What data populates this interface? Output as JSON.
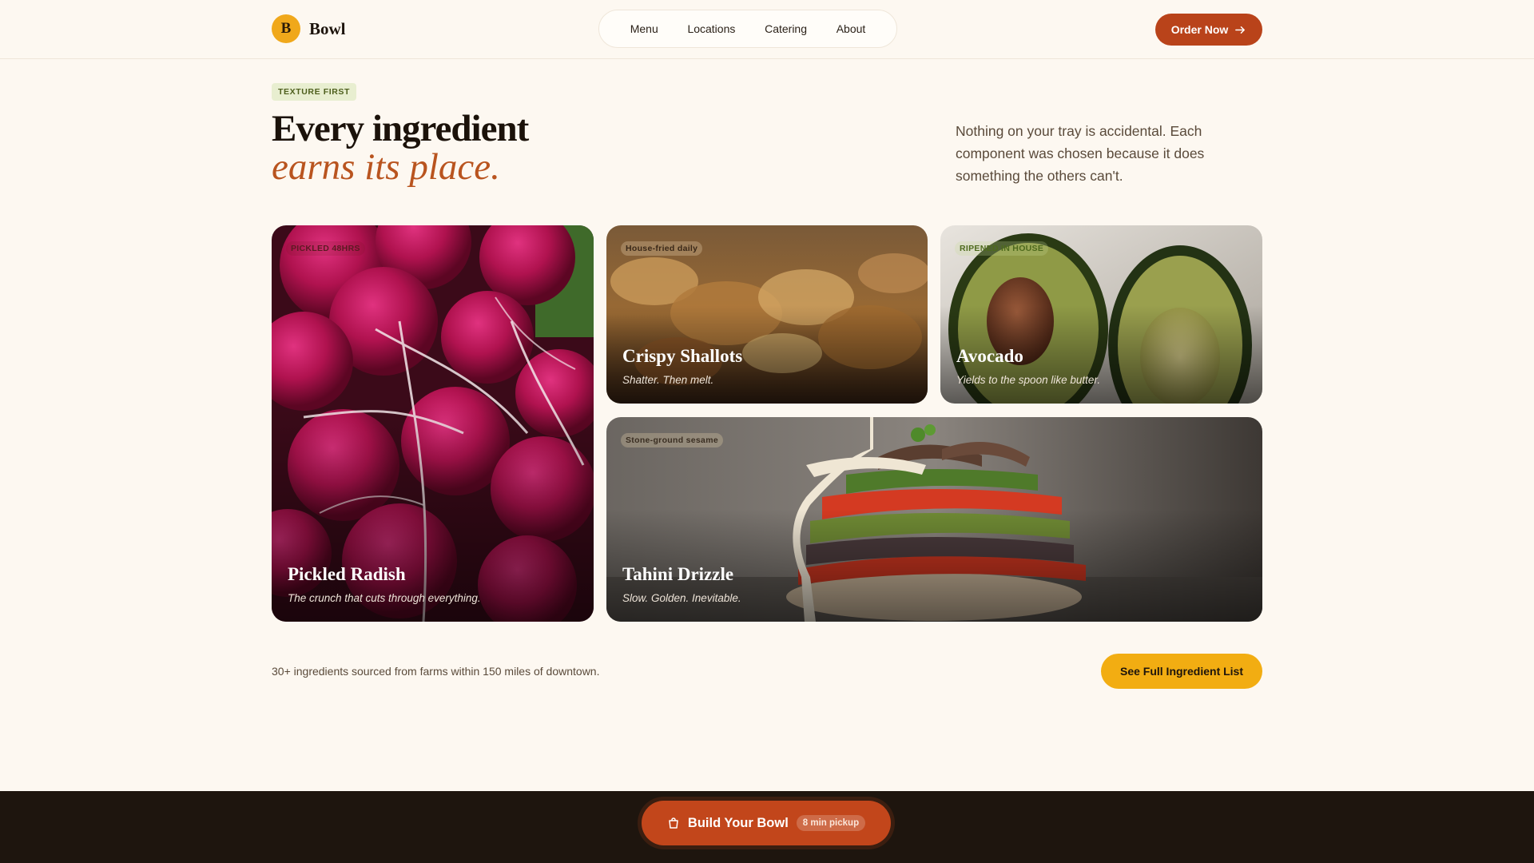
{
  "brand": {
    "mark": "B",
    "name": "Bowl"
  },
  "nav": {
    "items": [
      {
        "label": "Menu"
      },
      {
        "label": "Locations"
      },
      {
        "label": "Catering"
      },
      {
        "label": "About"
      }
    ],
    "cta_label": "Order Now",
    "cta_icon": "arrow-right-icon"
  },
  "hero": {
    "eyebrow": "TEXTURE FIRST",
    "headline": "Every ingredient",
    "headline_accent": "earns its place.",
    "intro": "Nothing on your tray is accidental. Each component was chosen because it does something the others can't."
  },
  "cards": [
    {
      "id": "radish",
      "tag": "PICKLED 48HRS",
      "title": "Pickled Radish",
      "subtitle": "The crunch that cuts through everything.",
      "image": "radishes-photo"
    },
    {
      "id": "shallots",
      "tag": "House-fried daily",
      "title": "Crispy Shallots",
      "subtitle": "Shatter. Then melt.",
      "image": "fried-shallots-photo"
    },
    {
      "id": "avocado",
      "tag": "RIPENED IN HOUSE",
      "title": "Avocado",
      "subtitle": "Yields to the spoon like butter.",
      "image": "avocado-halves-photo"
    },
    {
      "id": "tahini",
      "tag": "Stone-ground sesame",
      "title": "Tahini Drizzle",
      "subtitle": "Slow. Golden. Inevitable.",
      "image": "vegetable-stack-photo"
    }
  ],
  "sourcing": {
    "text": "30+ ingredients sourced from farms within 150 miles of downtown.",
    "button_label": "See Full Ingredient List"
  },
  "bottom_bar": {
    "button_label": "Build Your Bowl",
    "button_icon": "shopping-bag-icon",
    "badge": "8 min pickup"
  },
  "colors": {
    "background": "#fdf8f1",
    "brand_orange": "#b9431a",
    "accent_yellow": "#f2ad12",
    "accent_serif": "#b9541f",
    "footer_dark": "#1e150e"
  }
}
